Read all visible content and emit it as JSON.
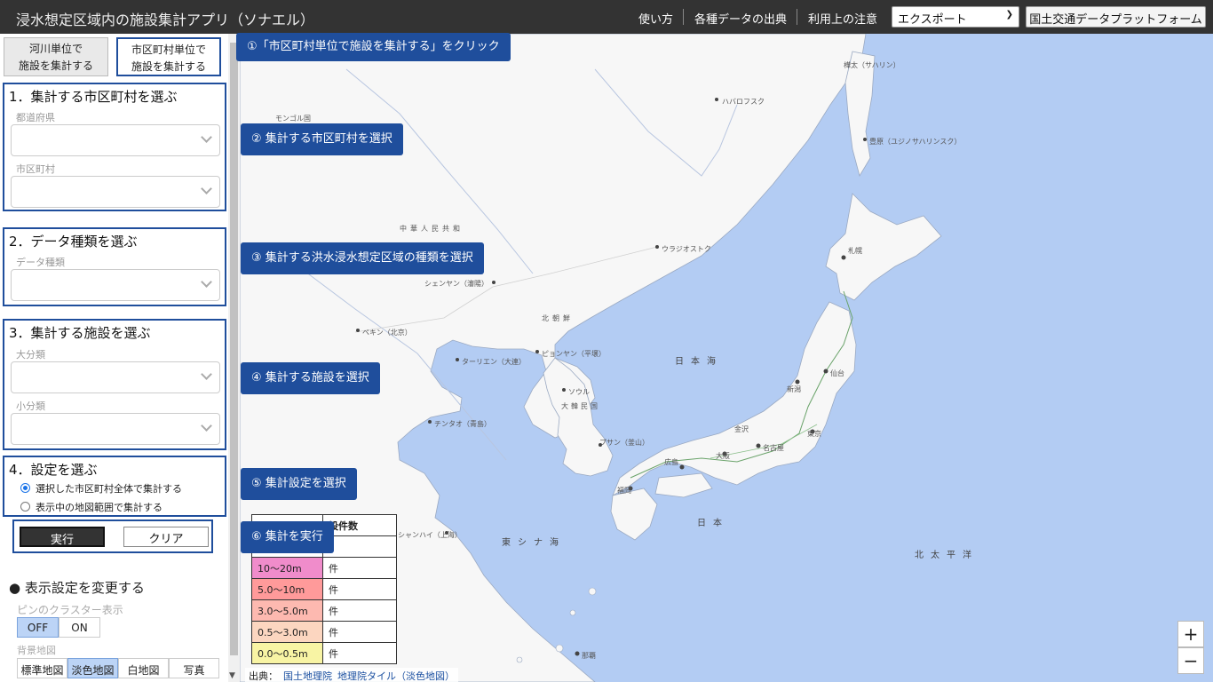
{
  "header": {
    "title": "浸水想定区域内の施設集計アプリ（ソナエル）",
    "links": [
      "使い方",
      "各種データの出典",
      "利用上の注意"
    ],
    "export_label": "エクスポート",
    "platform_label": "国土交通データプラットフォーム"
  },
  "tabs": {
    "river": [
      "河川単位で",
      "施設を集計する"
    ],
    "muni": [
      "市区町村単位で",
      "施設を集計する"
    ]
  },
  "section1": {
    "title": "1．集計する市区町村を選ぶ",
    "pref_label": "都道府県",
    "muni_label": "市区町村"
  },
  "section2": {
    "title": "2．データ種類を選ぶ",
    "type_label": "データ種類"
  },
  "section3": {
    "title": "3．集計する施設を選ぶ",
    "major_label": "大分類",
    "minor_label": "小分類"
  },
  "section4": {
    "title": "4．設定を選ぶ",
    "option_whole": "選択した市区町村全体で集計する",
    "option_view": "表示中の地図範囲で集計する",
    "selected": "whole"
  },
  "actions": {
    "run": "実行",
    "clear": "クリア"
  },
  "display": {
    "title": "● 表示設定を変更する",
    "cluster_label": "ピンのクラスター表示",
    "cluster_off": "OFF",
    "cluster_on": "ON",
    "cluster_selected": "OFF",
    "basemap_label": "背景地図",
    "basemaps": [
      "標準地図",
      "淡色地図",
      "白地図",
      "写真"
    ],
    "basemap_selected": "淡色地図"
  },
  "callouts": {
    "c1": "①「市区町村単位で施設を集計する」をクリック",
    "c2": "② 集計する市区町村を選択",
    "c3": "③ 集計する洪水浸水想定区域の種類を選択",
    "c4": "④ 集計する施設を選択",
    "c5": "⑤ 集計設定を選択",
    "c6": "⑥ 集計を実行"
  },
  "legend": {
    "header_count": "設件数",
    "rows": [
      {
        "label": "10～20m",
        "count": "件",
        "color": "#f08ccb"
      },
      {
        "label": "5.0～10m",
        "count": "件",
        "color": "#ff9a9a"
      },
      {
        "label": "3.0～5.0m",
        "count": "件",
        "color": "#fdb9b0"
      },
      {
        "label": "0.5～3.0m",
        "count": "件",
        "color": "#fcd6c0"
      },
      {
        "label": "0.0～0.5m",
        "count": "件",
        "color": "#f8f4a4"
      }
    ]
  },
  "zoom": {
    "in": "+",
    "out": "−"
  },
  "attribution": {
    "prefix": "出典：",
    "link1": "国土地理院",
    "link2": "地理院タイル（淡色地図）"
  },
  "map_labels": {
    "sakhalin": "樺太（サハリン）",
    "khabarovsk": "ハバロフスク",
    "yuzhno": "豊原（ユジノサハリンスク）",
    "vladivostok": "ウラジオストク",
    "china": "中華人民共和",
    "shenyang": "シェンヤン（瀋陽）",
    "beijing": "ペキン（北京）",
    "dalian": "ターリエン（大連）",
    "pyongyang": "ピョンヤン（平壌）",
    "north_korea": "北朝鮮",
    "seoul": "ソウル",
    "south_korea": "大韓民国",
    "qingdao": "チンタオ（青島）",
    "busan": "プサン（釜山）",
    "shanghai": "シャンハイ（上海）",
    "sapporo": "札幌",
    "sendai": "仙台",
    "niigata": "新潟",
    "tokyo": "東京",
    "nagoya": "名古屋",
    "osaka": "大阪",
    "hiroshima": "広島",
    "fukuoka": "福岡",
    "naha": "那覇",
    "kanazawa": "金沢",
    "sea_of_japan": "日本海",
    "east_china_sea": "東シナ海",
    "pacific": "北太平洋",
    "japan": "日本",
    "mongol": "モンゴル国"
  },
  "colors": {
    "callout": "#1f4e9c",
    "sea": "#b3ccf3",
    "land": "#f7f7f7",
    "topbar": "#333333"
  }
}
